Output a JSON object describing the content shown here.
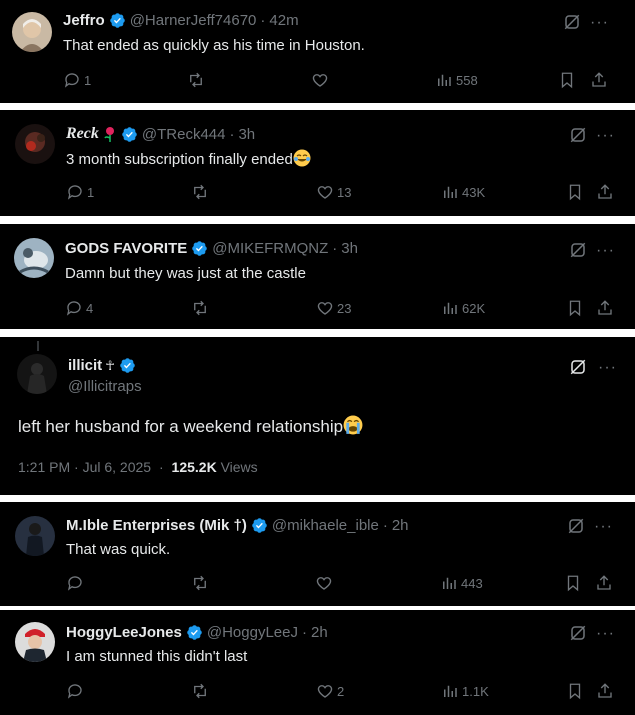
{
  "colors": {
    "background": "#000000",
    "text": "#e7e9ea",
    "muted": "#71767b",
    "verified": "#1d9bf0",
    "separator": "#ffffff"
  },
  "icons": {
    "reply": "reply-icon",
    "repost": "repost-icon",
    "like": "heart-icon",
    "views": "views-icon",
    "bookmark": "bookmark-icon",
    "share": "share-icon",
    "grok": "grok-icon",
    "more": "more-icon",
    "verified": "verified-badge-icon"
  },
  "replies": [
    {
      "name": "Jeffro",
      "handle": "@HarnerJeff74670",
      "time": "42m",
      "text": "That ended as quickly as his time in Houston.",
      "reply_count": "1",
      "repost_count": "",
      "like_count": "",
      "views": "558"
    },
    {
      "name": "Reck",
      "handle": "@TReck444",
      "time": "3h",
      "text": "3 month subscription finally ended",
      "emoji": "😂",
      "reply_count": "1",
      "repost_count": "",
      "like_count": "13",
      "views": "43K"
    },
    {
      "name": "GODS FAVORITE",
      "handle": "@MIKEFRMQNZ",
      "time": "3h",
      "text": "Damn but they was just at the castle",
      "reply_count": "4",
      "repost_count": "",
      "like_count": "23",
      "views": "62K"
    },
    {
      "name": "M.Ible Enterprises (Mik †)",
      "handle": "@mikhaele_ible",
      "time": "2h",
      "text": "That was quick.",
      "reply_count": "",
      "repost_count": "",
      "like_count": "",
      "views": "443"
    },
    {
      "name": "HoggyLeeJones",
      "handle": "@HoggyLeeJ",
      "time": "2h",
      "text": "I am stunned this didn't last",
      "reply_count": "",
      "repost_count": "",
      "like_count": "2",
      "views": "1.1K"
    }
  ],
  "main_post": {
    "name": "illicit",
    "name_symbol": "☥",
    "handle": "@Illicitraps",
    "text": "left her husband for a weekend relationship",
    "emoji": "😭",
    "timestamp": "1:21 PM · Jul 6, 2025",
    "views_count": "125.2K",
    "views_label": "Views"
  },
  "dot": "·",
  "more": "···"
}
